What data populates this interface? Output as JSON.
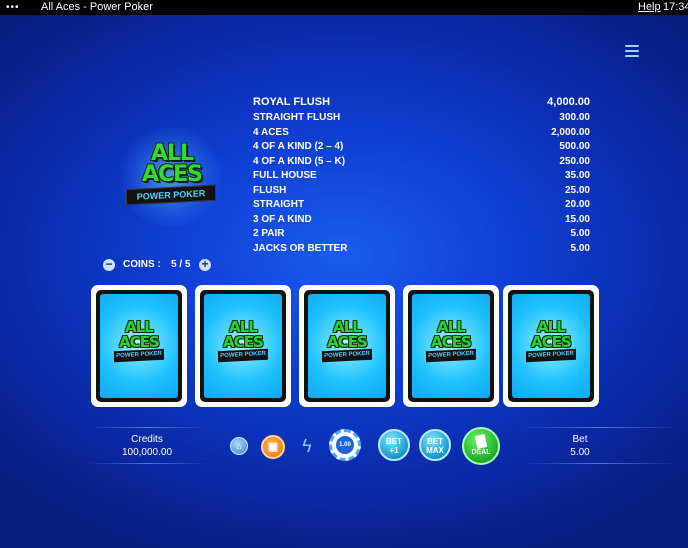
{
  "window": {
    "menu_dots": "•••",
    "title": "All Aces - Power Poker",
    "help": "Help",
    "clock": "17:34"
  },
  "logo": {
    "line1": "ALL",
    "line2": "ACES",
    "banner": "POWER POKER"
  },
  "coins": {
    "minus": "−",
    "label": "COINS :",
    "value": "5 / 5",
    "plus": "+"
  },
  "paytable": [
    {
      "hand": "ROYAL FLUSH",
      "payout": "4,000.00"
    },
    {
      "hand": "STRAIGHT FLUSH",
      "payout": "300.00"
    },
    {
      "hand": "4 ACES",
      "payout": "2,000.00"
    },
    {
      "hand": "4 OF A KIND (2 – 4)",
      "payout": "500.00"
    },
    {
      "hand": "4 OF A KIND (5 – K)",
      "payout": "250.00"
    },
    {
      "hand": "FULL HOUSE",
      "payout": "35.00"
    },
    {
      "hand": "FLUSH",
      "payout": "25.00"
    },
    {
      "hand": "STRAIGHT",
      "payout": "20.00"
    },
    {
      "hand": "3 OF A KIND",
      "payout": "15.00"
    },
    {
      "hand": "2 PAIR",
      "payout": "5.00"
    },
    {
      "hand": "JACKS OR BETTER",
      "payout": "5.00"
    }
  ],
  "card_back": {
    "line1": "ALL",
    "line2": "ACES",
    "banner": "POWER POKER"
  },
  "bottom": {
    "credits_label": "Credits",
    "credits_value": "100,000.00",
    "bet_label": "Bet",
    "bet_value": "5.00",
    "chip_value": "1.00",
    "bet_one_line1": "BET",
    "bet_one_line2": "+1",
    "bet_max_line1": "BET",
    "bet_max_line2": "MAX",
    "deal_label": "DEAL",
    "bank_icon": "bank-icon",
    "autoplay_icon": "autoplay-icon",
    "bolt_icon": "lightning-icon"
  }
}
